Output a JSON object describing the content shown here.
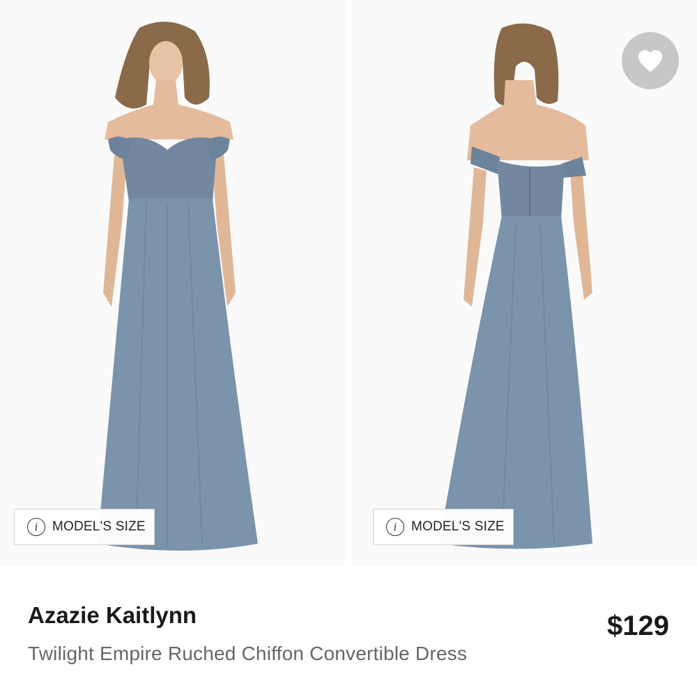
{
  "gallery": {
    "images": [
      {
        "view": "front",
        "model_size_label": "MODEL'S SIZE"
      },
      {
        "view": "back",
        "model_size_label": "MODEL'S SIZE"
      }
    ],
    "favorite_icon": "heart-icon",
    "info_icon": "info-icon"
  },
  "product": {
    "name": "Azazie Kaitlynn",
    "description": "Twilight Empire Ruched Chiffon Convertible Dress",
    "price": "$129"
  },
  "colors": {
    "dress": "#7b93ab",
    "price_text": "#1a1a1a",
    "description_text": "#666666",
    "favorite_bg": "#c7c7c7"
  }
}
